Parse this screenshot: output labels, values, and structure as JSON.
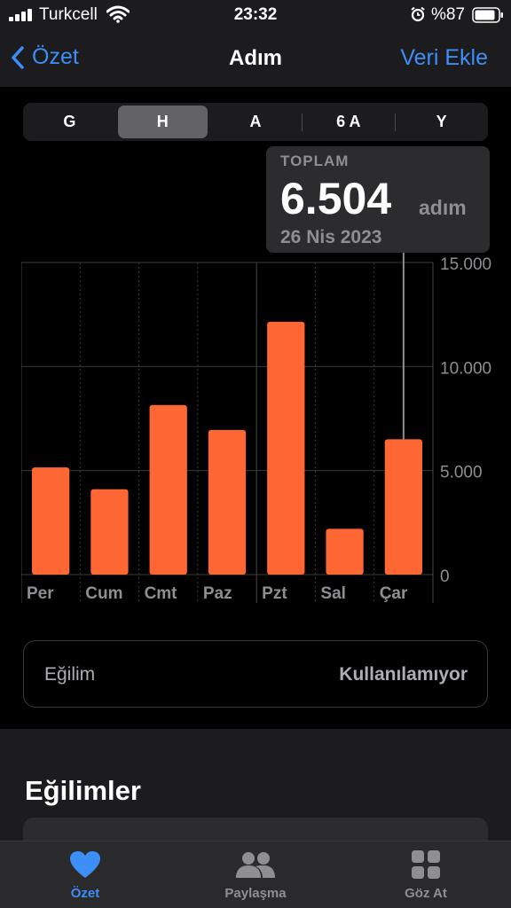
{
  "status": {
    "carrier": "Turkcell",
    "time": "23:32",
    "battery": "%87"
  },
  "nav": {
    "back": "Özet",
    "title": "Adım",
    "action": "Veri Ekle"
  },
  "ranges": [
    "G",
    "H",
    "A",
    "6 A",
    "Y"
  ],
  "selected_range": "H",
  "tooltip": {
    "label": "TOPLAM",
    "value": "6.504",
    "unit": "adım",
    "date": "26 Nis 2023"
  },
  "colors": {
    "accent": "#3d8ef7",
    "bar": "#fe6633"
  },
  "chart_data": {
    "type": "bar",
    "categories": [
      "Per",
      "Cum",
      "Cmt",
      "Paz",
      "Pzt",
      "Sal",
      "Çar"
    ],
    "values": [
      5150,
      4100,
      8150,
      6950,
      12150,
      2200,
      6504
    ],
    "ylim": [
      0,
      15000
    ],
    "yticks": [
      "15.000",
      "10.000",
      "5.000",
      "0"
    ],
    "ytick_values": [
      15000,
      10000,
      5000,
      0
    ],
    "highlighted": "Çar",
    "grid": true
  },
  "trend": {
    "label": "Eğilim",
    "value": "Kullanılamıyor"
  },
  "section_title": "Eğilimler",
  "tabs": [
    {
      "label": "Özet",
      "icon": "heart-icon",
      "active": true
    },
    {
      "label": "Paylaşma",
      "icon": "people-icon",
      "active": false
    },
    {
      "label": "Göz At",
      "icon": "grid-icon",
      "active": false
    }
  ]
}
